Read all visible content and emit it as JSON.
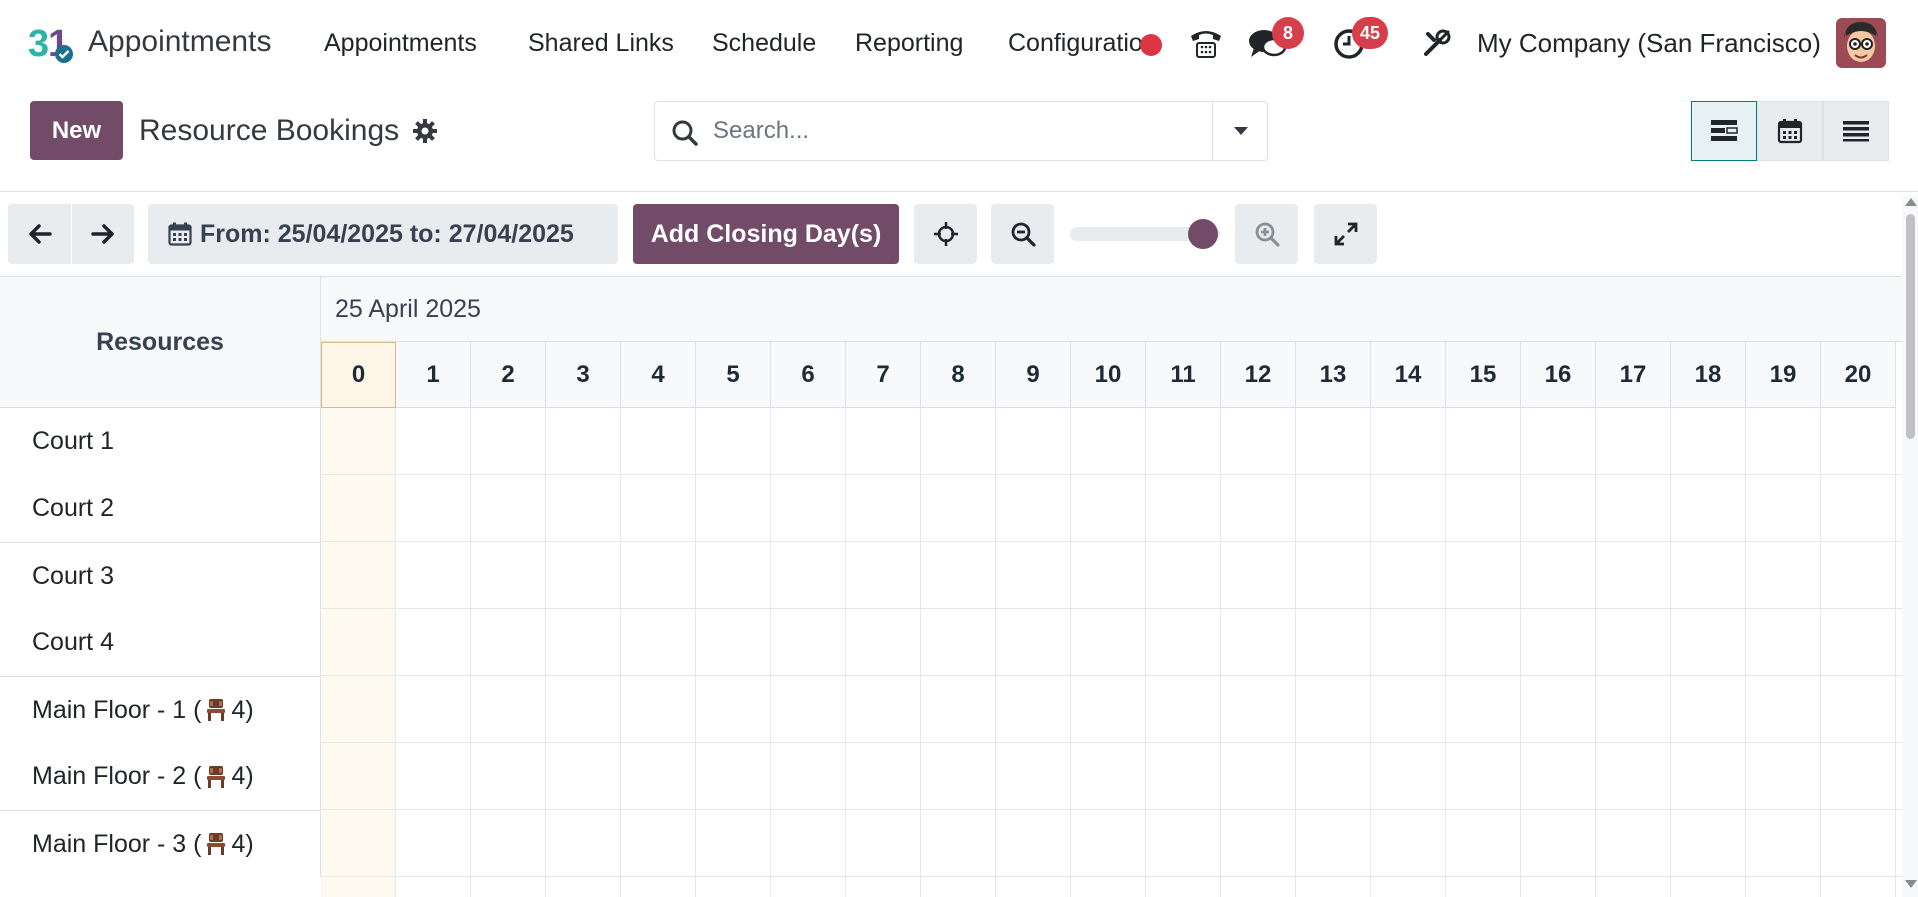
{
  "navbar": {
    "app_name": "Appointments",
    "menu": [
      "Appointments",
      "Shared Links",
      "Schedule",
      "Reporting",
      "Configuration"
    ],
    "messages_count": "8",
    "activities_count": "45",
    "company": "My Company (San Francisco)"
  },
  "control_panel": {
    "new_label": "New",
    "title": "Resource Bookings",
    "search_placeholder": "Search..."
  },
  "toolbar": {
    "date_range": "From: 25/04/2025 to: 27/04/2025",
    "closing_days_label": "Add Closing Day(s)",
    "zoom_level": 0.75
  },
  "gantt": {
    "resources_header": "Resources",
    "date_label": "25 April 2025",
    "hours": [
      "0",
      "1",
      "2",
      "3",
      "4",
      "5",
      "6",
      "7",
      "8",
      "9",
      "10",
      "11",
      "12",
      "13",
      "14",
      "15",
      "16",
      "17",
      "18",
      "19",
      "20"
    ],
    "rows": [
      {
        "name": "Court 1",
        "capacity": ""
      },
      {
        "name": "Court 2",
        "capacity": ""
      },
      {
        "name": "Court 3",
        "capacity": ""
      },
      {
        "name": "Court 4",
        "capacity": ""
      },
      {
        "name": "Main Floor - 1 (",
        "capacity": "4)"
      },
      {
        "name": "Main Floor - 2 (",
        "capacity": "4)"
      },
      {
        "name": "Main Floor - 3 (",
        "capacity": "4)"
      }
    ]
  },
  "colors": {
    "brand": "#714b67",
    "badge": "#d63e4b",
    "today_column": "#fffaef"
  }
}
